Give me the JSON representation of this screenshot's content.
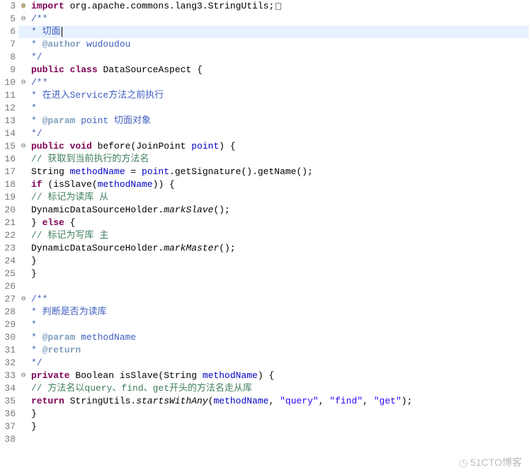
{
  "lines": {
    "l3": {
      "num": "3",
      "fold": "⊕",
      "import_kw": "import",
      "import_path": " org.apache.commons.lang3.StringUtils;"
    },
    "l5": {
      "num": "5",
      "fold": "⊖",
      "doc": "/**"
    },
    "l6": {
      "num": "6",
      "fold": "",
      "doc_star": " * ",
      "doc_text": "切面"
    },
    "l7": {
      "num": "7",
      "fold": "",
      "doc_star": " * ",
      "tag": "@author",
      "tag_val": " wudoudou"
    },
    "l8": {
      "num": "8",
      "fold": "",
      "doc": " */"
    },
    "l9": {
      "num": "9",
      "fold": "",
      "kw1": "public",
      "kw2": "class",
      "name": " DataSourceAspect {"
    },
    "l10": {
      "num": "10",
      "fold": "⊖",
      "doc": "/**"
    },
    "l11": {
      "num": "11",
      "fold": "",
      "doc_star": " * ",
      "doc_text": "在进入Service方法之前执行"
    },
    "l12": {
      "num": "12",
      "fold": "",
      "doc": " *"
    },
    "l13": {
      "num": "13",
      "fold": "",
      "doc_star": " * ",
      "tag": "@param",
      "tag_val": " point 切面对象"
    },
    "l14": {
      "num": "14",
      "fold": "",
      "doc": " */"
    },
    "l15": {
      "num": "15",
      "fold": "⊖",
      "kw1": "public",
      "kw2": "void",
      "name": " before(JoinPoint ",
      "param": "point",
      "rest": ") {"
    },
    "l16": {
      "num": "16",
      "fold": "",
      "com": "// 获取到当前执行的方法名"
    },
    "l17": {
      "num": "17",
      "fold": "",
      "t1": "String ",
      "var": "methodName",
      "t2": " = ",
      "p": "point",
      "t3": ".getSignature().getName();"
    },
    "l18": {
      "num": "18",
      "fold": "",
      "kw": "if",
      "t1": " (isSlave(",
      "p": "methodName",
      "t2": ")) {"
    },
    "l19": {
      "num": "19",
      "fold": "",
      "com": "// 标记为读库  从"
    },
    "l20": {
      "num": "20",
      "fold": "",
      "t1": "DynamicDataSourceHolder.",
      "m": "markSlave",
      "t2": "();"
    },
    "l21": {
      "num": "21",
      "fold": "",
      "t1": "} ",
      "kw": "else",
      "t2": " {"
    },
    "l22": {
      "num": "22",
      "fold": "",
      "com": "// 标记为写库 主"
    },
    "l23": {
      "num": "23",
      "fold": "",
      "t1": "DynamicDataSourceHolder.",
      "m": "markMaster",
      "t2": "();"
    },
    "l24": {
      "num": "24",
      "fold": "",
      "t": "}"
    },
    "l25": {
      "num": "25",
      "fold": "",
      "t": "}"
    },
    "l26": {
      "num": "26",
      "fold": ""
    },
    "l27": {
      "num": "27",
      "fold": "⊖",
      "doc": "/**"
    },
    "l28": {
      "num": "28",
      "fold": "",
      "doc_star": " * ",
      "doc_text": "判断是否为读库"
    },
    "l29": {
      "num": "29",
      "fold": "",
      "doc": " *"
    },
    "l30": {
      "num": "30",
      "fold": "",
      "doc_star": " * ",
      "tag": "@param",
      "tag_val": " methodName"
    },
    "l31": {
      "num": "31",
      "fold": "",
      "doc_star": " * ",
      "tag": "@return"
    },
    "l32": {
      "num": "32",
      "fold": "",
      "doc": " */"
    },
    "l33": {
      "num": "33",
      "fold": "⊖",
      "kw1": "private",
      "t1": " Boolean isSlave(String ",
      "param": "methodName",
      "t2": ") {"
    },
    "l34": {
      "num": "34",
      "fold": "",
      "com": "// 方法名以query、find、get开头的方法名走从库"
    },
    "l35": {
      "num": "35",
      "fold": "",
      "kw": "return",
      "t1": " StringUtils.",
      "m": "startsWithAny",
      "t2": "(",
      "p": "methodName",
      "t3": ", ",
      "s1": "\"query\"",
      "t4": ", ",
      "s2": "\"find\"",
      "t5": ", ",
      "s3": "\"get\"",
      "t6": ");"
    },
    "l36": {
      "num": "36",
      "fold": "",
      "t": "}"
    },
    "l37": {
      "num": "37",
      "fold": "",
      "t": "}"
    },
    "l38": {
      "num": "38",
      "fold": ""
    }
  },
  "watermark": "51CTO博客"
}
